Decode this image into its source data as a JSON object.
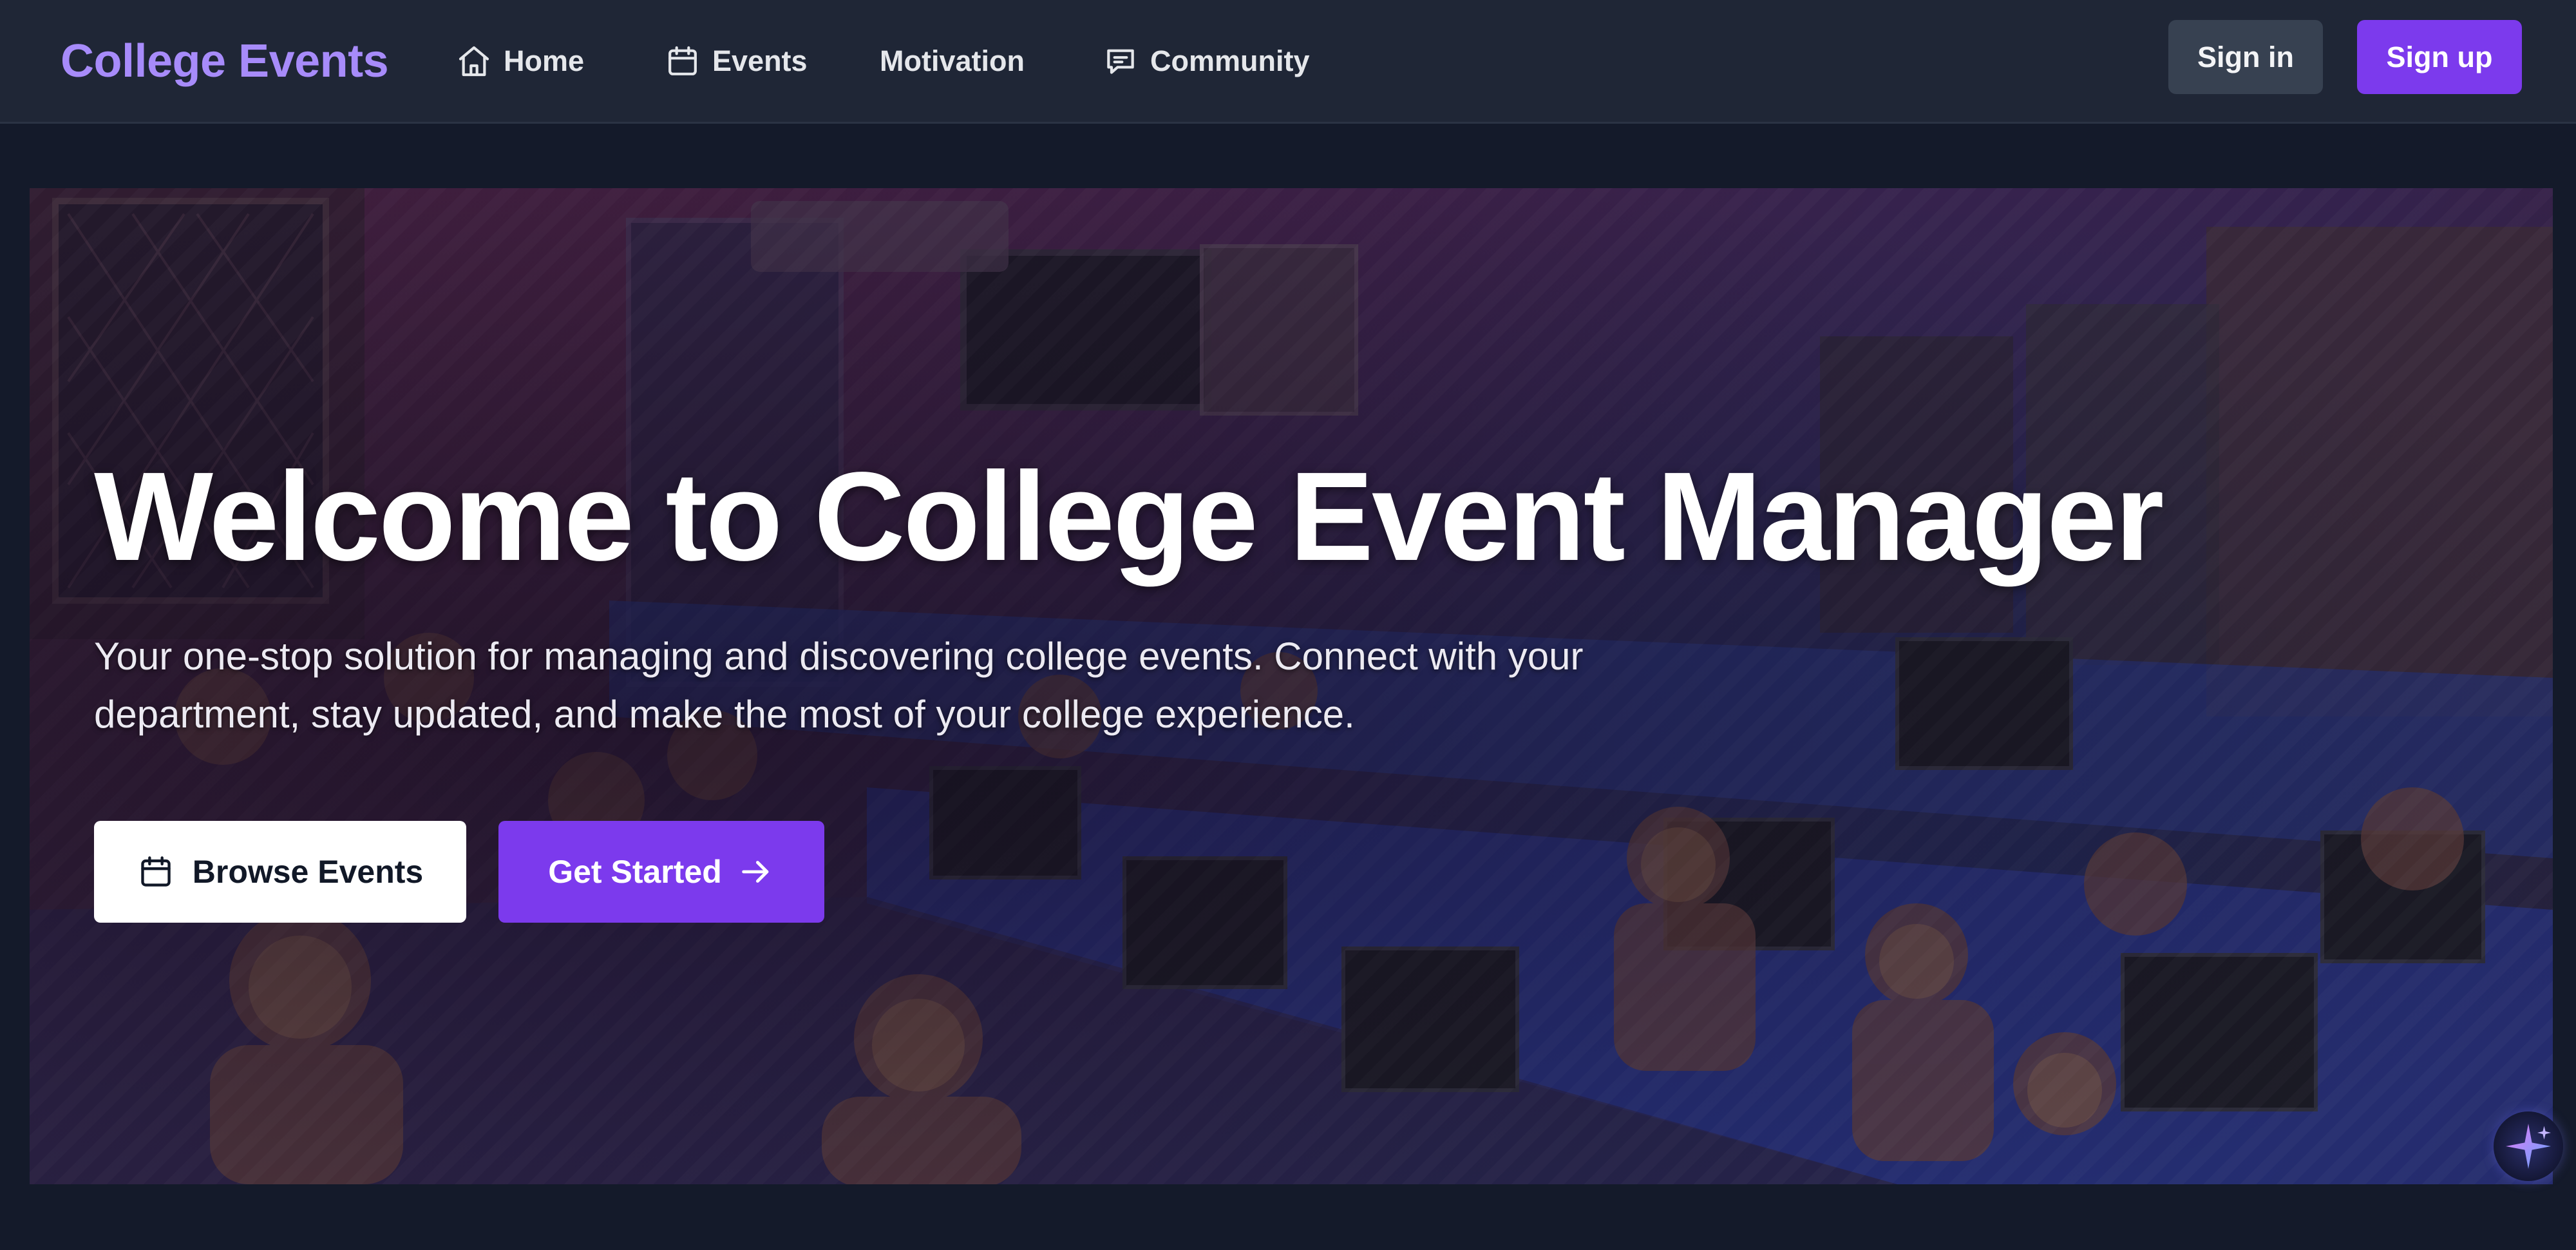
{
  "navbar": {
    "brand": "College Events",
    "links": [
      {
        "label": "Home",
        "icon": "home-icon"
      },
      {
        "label": "Events",
        "icon": "calendar-icon"
      },
      {
        "label": "Motivation"
      },
      {
        "label": "Community",
        "icon": "chat-icon"
      }
    ],
    "signin_label": "Sign in",
    "signup_label": "Sign up"
  },
  "hero": {
    "title": "Welcome to College Event Manager",
    "subtitle": "Your one-stop solution for managing and discovering college events. Connect with your department, stay updated, and make the most of your college experience.",
    "browse_label": "Browse Events",
    "browse_icon": "calendar-icon",
    "started_label": "Get Started",
    "started_icon": "arrow-right-icon",
    "background": "illustrated computer lab with students, purple overlay"
  },
  "assistant": {
    "icon": "sparkle-icon"
  },
  "colors": {
    "accent": "#7c3aed",
    "brand": "#a78bfa",
    "navbar_bg": "#1f2636",
    "page_bg": "#141a2a"
  }
}
